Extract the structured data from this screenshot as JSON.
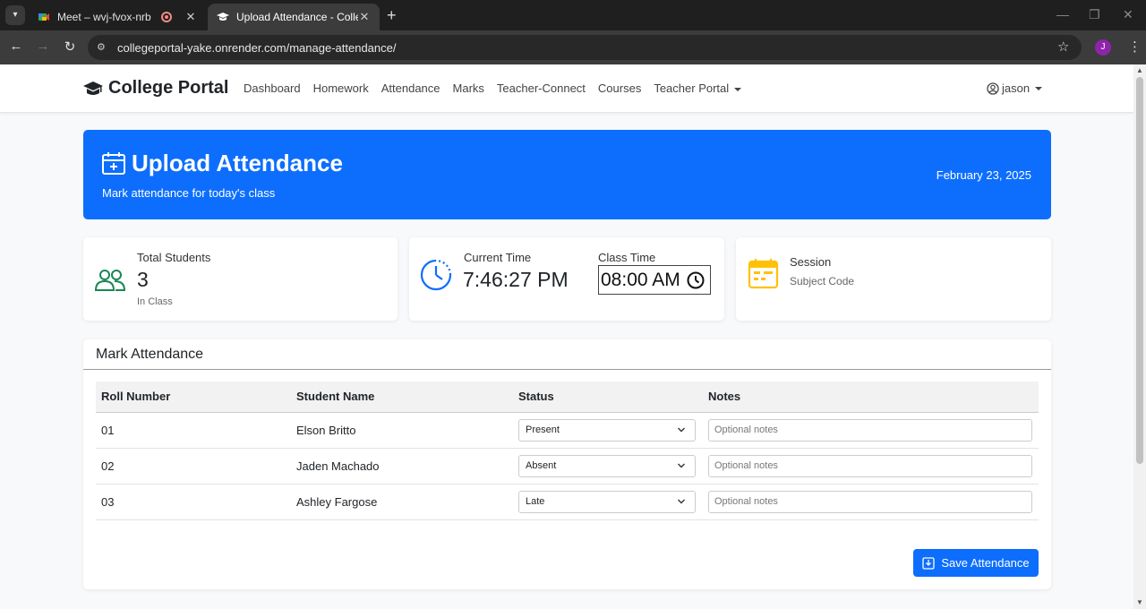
{
  "browser": {
    "tabs": [
      {
        "title": "Meet – wvj-fvox-nrb"
      },
      {
        "title": "Upload Attendance - College Portal"
      }
    ],
    "url": "collegeportal-yake.onrender.com/manage-attendance/",
    "profile_initial": "J"
  },
  "navbar": {
    "brand": "College Portal",
    "links": [
      "Dashboard",
      "Homework",
      "Attendance",
      "Marks",
      "Teacher-Connect",
      "Courses",
      "Teacher Portal"
    ],
    "user": "jason"
  },
  "hero": {
    "title": "Upload Attendance",
    "subtitle": "Mark attendance for today's class",
    "date": "February 23, 2025"
  },
  "stats": {
    "total": {
      "label": "Total Students",
      "value": "3",
      "caption": "In Class"
    },
    "time": {
      "label": "Current Time",
      "value": "7:46:27 PM",
      "class_label": "Class Time",
      "class_value": "08:00 AM"
    },
    "session": {
      "label": "Session",
      "caption": "Subject Code"
    }
  },
  "attendance": {
    "heading": "Mark Attendance",
    "columns": [
      "Roll Number",
      "Student Name",
      "Status",
      "Notes"
    ],
    "rows": [
      {
        "roll": "01",
        "name": "Elson Britto",
        "status": "Present",
        "notes_placeholder": "Optional notes"
      },
      {
        "roll": "02",
        "name": "Jaden Machado",
        "status": "Absent",
        "notes_placeholder": "Optional notes"
      },
      {
        "roll": "03",
        "name": "Ashley Fargose",
        "status": "Late",
        "notes_placeholder": "Optional notes"
      }
    ],
    "save_label": "Save Attendance"
  },
  "colors": {
    "primary": "#0d6efd",
    "success_icon": "#198754",
    "info_icon": "#0d6efd",
    "warning_icon": "#ffc107"
  },
  "icons": [
    "graduation-cap-icon",
    "calendar-plus-icon",
    "people-icon",
    "clock-icon",
    "calendar-week-icon",
    "user-circle-icon",
    "save-icon"
  ]
}
